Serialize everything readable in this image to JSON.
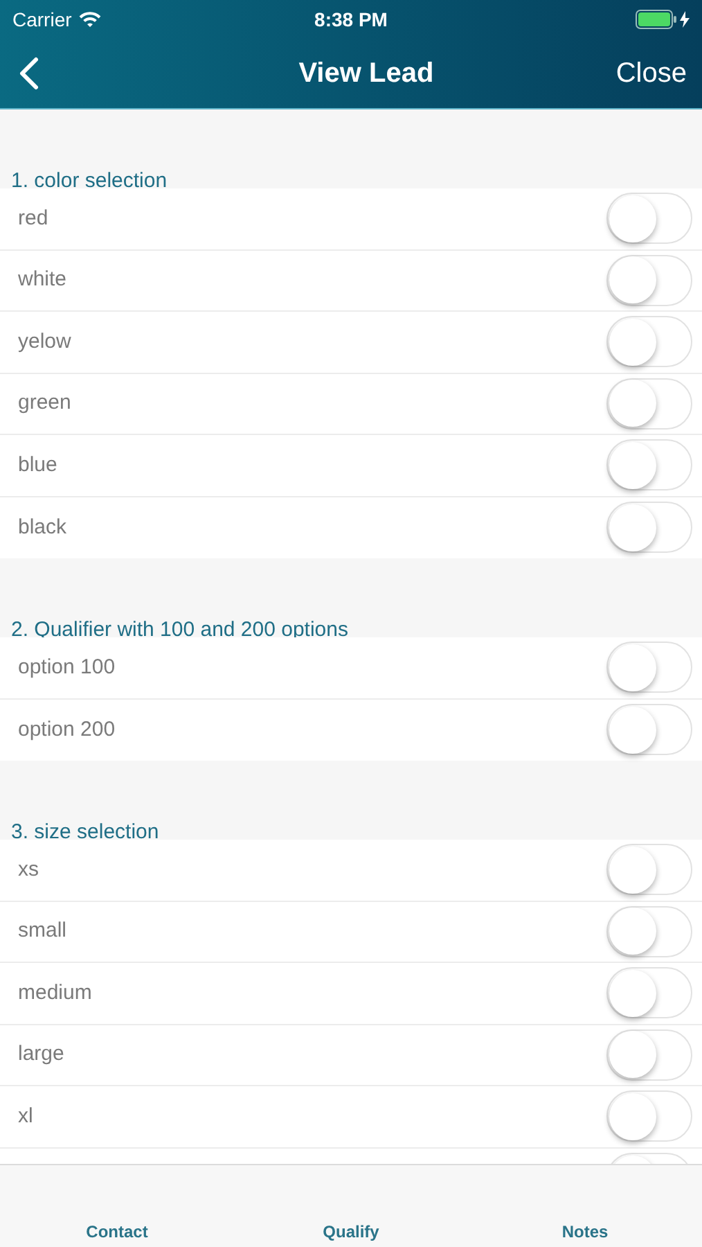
{
  "status_bar": {
    "carrier": "Carrier",
    "time": "8:38 PM"
  },
  "nav_bar": {
    "title": "View Lead",
    "close": "Close"
  },
  "sections": [
    {
      "title": "1. color selection",
      "items": [
        {
          "label": "red",
          "on": false
        },
        {
          "label": "white",
          "on": false
        },
        {
          "label": "yelow",
          "on": false
        },
        {
          "label": "green",
          "on": false
        },
        {
          "label": "blue",
          "on": false
        },
        {
          "label": "black",
          "on": false
        }
      ]
    },
    {
      "title": "2. Qualifier with 100 and 200 options",
      "items": [
        {
          "label": "option 100",
          "on": false
        },
        {
          "label": "option 200",
          "on": false
        }
      ]
    },
    {
      "title": "3. size selection",
      "items": [
        {
          "label": "xs",
          "on": false
        },
        {
          "label": "small",
          "on": false
        },
        {
          "label": "medium",
          "on": false
        },
        {
          "label": "large",
          "on": false
        },
        {
          "label": "xl",
          "on": false
        },
        {
          "on": false
        }
      ]
    }
  ],
  "tabs": [
    {
      "label": "Contact"
    },
    {
      "label": "Qualify"
    },
    {
      "label": "Notes"
    }
  ]
}
